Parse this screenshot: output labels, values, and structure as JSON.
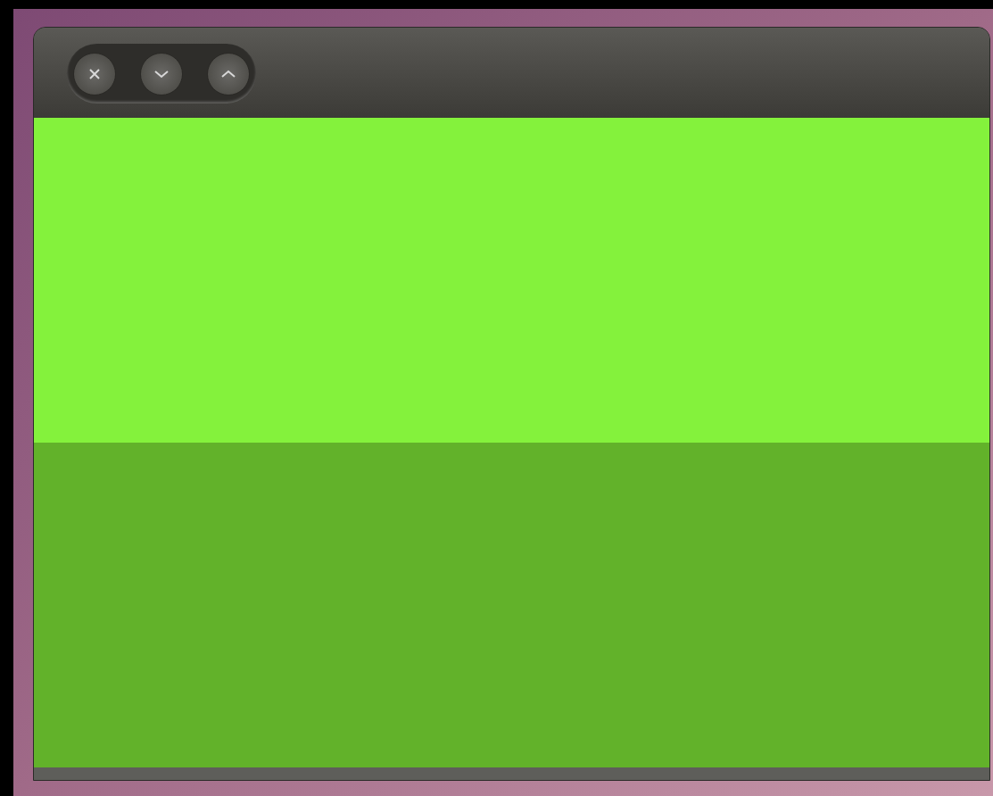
{
  "window": {
    "controls": [
      {
        "kind": "close"
      },
      {
        "kind": "minimize"
      },
      {
        "kind": "maximize"
      }
    ],
    "panels": [
      {
        "color": "#84f23c"
      },
      {
        "color": "#62b22a"
      }
    ]
  }
}
